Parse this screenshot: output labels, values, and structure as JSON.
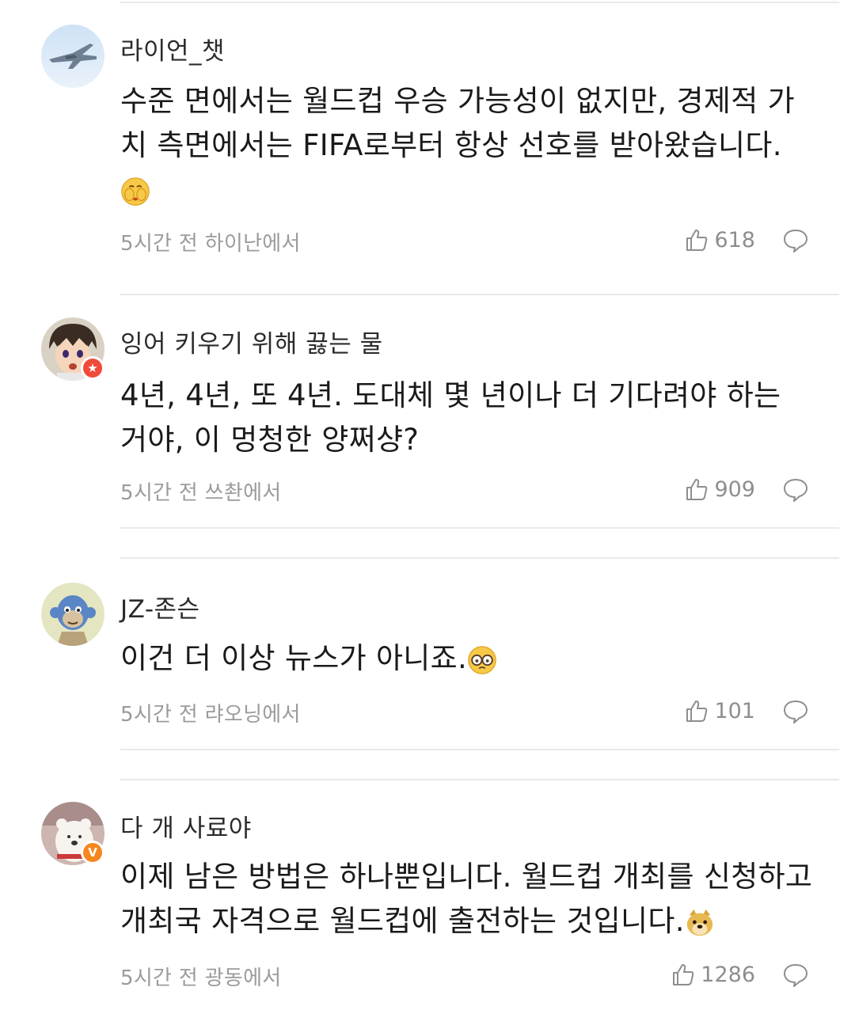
{
  "comments": [
    {
      "username": "라이언_챗",
      "text": "수준 면에서는 월드컵 우승 가능성이 없지만, 경제적 가치 측면에서는 FIFA로부터 항상 선호를 받아왔습니다.",
      "emoji": "embarrassed-face-emoji",
      "meta": "5시간 전 하이난에서",
      "likes": "618",
      "avatar": "fighter-jet-avatar"
    },
    {
      "username": "잉어 키우기 위해 끓는 물",
      "text": "4년, 4년, 또 4년. 도대체 몇 년이나 더 기다려야 하는 거야, 이 멍청한 양쩌샹?",
      "meta": "5시간 전 쓰촨에서",
      "likes": "909",
      "avatar": "anime-boy-avatar",
      "badge": "star-badge"
    },
    {
      "username": "JZ-존슨",
      "text": "이건 더 이상 뉴스가 아니죠.",
      "emoji": "glasses-face-emoji",
      "meta": "5시간 전 랴오닝에서",
      "likes": "101",
      "avatar": "ape-avatar"
    },
    {
      "username": "다 개 사료야",
      "text": "이제 남은 방법은 하나뿐입니다. 월드컵 개최를 신청하고 개최국 자격으로 월드컵에 출전하는 것입니다.",
      "emoji": "doge-emoji",
      "meta": "5시간 전 광동에서",
      "likes": "1286",
      "avatar": "bear-avatar",
      "badge": "v-badge"
    }
  ],
  "colors": {
    "divider": "#e9e9e9",
    "meta": "#9b9b9b",
    "badge_red": "#f04a3a",
    "badge_orange": "#f6871f"
  }
}
